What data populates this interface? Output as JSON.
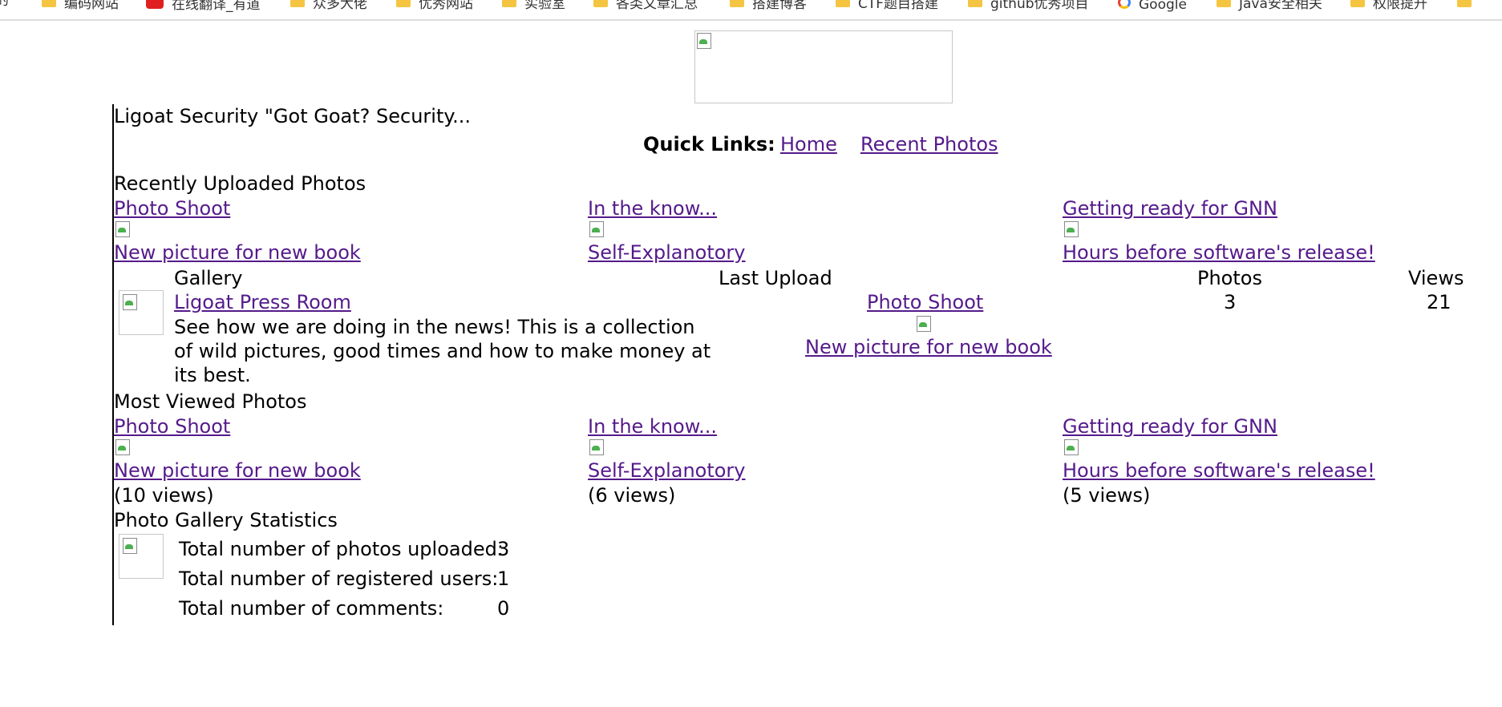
{
  "bookmarks": [
    {
      "label": "编码网站",
      "icon": "folder-icon"
    },
    {
      "label": "在线翻译_有道",
      "icon": "youdao-icon"
    },
    {
      "label": "众多大佬",
      "icon": "folder-icon"
    },
    {
      "label": "优秀网站",
      "icon": "folder-icon"
    },
    {
      "label": "实验室",
      "icon": "folder-icon"
    },
    {
      "label": "各类文章汇总",
      "icon": "folder-icon"
    },
    {
      "label": "搭建博客",
      "icon": "folder-icon"
    },
    {
      "label": "CTF题目搭建",
      "icon": "folder-icon"
    },
    {
      "label": "github优秀项目",
      "icon": "folder-icon"
    },
    {
      "label": "Google",
      "icon": "google-icon"
    },
    {
      "label": "Java安全相关",
      "icon": "folder-icon"
    },
    {
      "label": "权限提升",
      "icon": "folder-icon"
    }
  ],
  "site": {
    "tagline": "Ligoat Security \"Got Goat? Security..."
  },
  "quick_links": {
    "label": "Quick Links:",
    "home": "Home",
    "recent": "Recent Photos"
  },
  "recent": {
    "heading": "Recently Uploaded Photos",
    "items": [
      {
        "title": "Photo Shoot",
        "caption": "New picture for new book"
      },
      {
        "title": "In the know...",
        "caption": "Self-Explanotory"
      },
      {
        "title": "Getting ready for GNN",
        "caption": "Hours before software's release!"
      }
    ]
  },
  "gallery_table": {
    "headers": {
      "gallery": "Gallery",
      "last_upload": "Last Upload",
      "photos": "Photos",
      "views": "Views"
    },
    "row": {
      "name": "Ligoat Press Room",
      "description": "See how we are doing in the news! This is a collection of wild pictures, good times and how to make money at its best.",
      "last_upload_title": "Photo Shoot",
      "last_upload_caption": "New picture for new book",
      "photos": "3",
      "views": "21"
    }
  },
  "most_viewed": {
    "heading": "Most Viewed Photos",
    "items": [
      {
        "title": "Photo Shoot",
        "caption": "New picture for new book",
        "views": "(10 views)"
      },
      {
        "title": "In the know...",
        "caption": "Self-Explanotory",
        "views": "(6 views)"
      },
      {
        "title": "Getting ready for GNN",
        "caption": "Hours before software's release!",
        "views": "(5 views)"
      }
    ]
  },
  "stats": {
    "heading": "Photo Gallery Statistics",
    "rows": [
      {
        "label": "Total number of photos uploaded:",
        "value": "3"
      },
      {
        "label": "Total number of registered users:",
        "value": "1"
      },
      {
        "label": "Total number of comments:",
        "value": "0"
      }
    ]
  }
}
